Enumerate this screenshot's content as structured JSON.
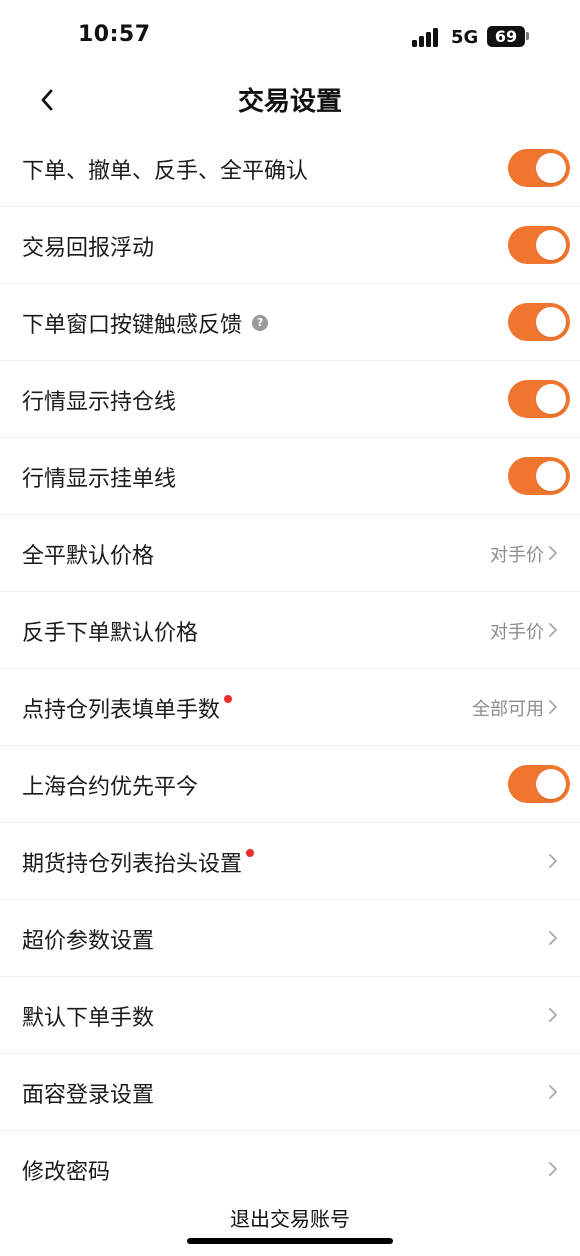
{
  "status_bar": {
    "time": "10:57",
    "network": "5G",
    "battery": "69"
  },
  "header": {
    "title": "交易设置"
  },
  "settings": [
    {
      "label": "下单、撤单、反手、全平确认",
      "type": "toggle",
      "enabled": true
    },
    {
      "label": "交易回报浮动",
      "type": "toggle",
      "enabled": true
    },
    {
      "label": "下单窗口按键触感反馈",
      "type": "toggle",
      "enabled": true,
      "has_help": true
    },
    {
      "label": "行情显示持仓线",
      "type": "toggle",
      "enabled": true
    },
    {
      "label": "行情显示挂单线",
      "type": "toggle",
      "enabled": true
    },
    {
      "label": "全平默认价格",
      "type": "value",
      "value": "对手价"
    },
    {
      "label": "反手下单默认价格",
      "type": "value",
      "value": "对手价"
    },
    {
      "label": "点持仓列表填单手数",
      "type": "value",
      "value": "全部可用",
      "badge": true
    },
    {
      "label": "上海合约优先平今",
      "type": "toggle",
      "enabled": true
    },
    {
      "label": "期货持仓列表抬头设置",
      "type": "link",
      "badge": true
    },
    {
      "label": "超价参数设置",
      "type": "link"
    },
    {
      "label": "默认下单手数",
      "type": "link"
    },
    {
      "label": "面容登录设置",
      "type": "link"
    },
    {
      "label": "修改密码",
      "type": "link"
    }
  ],
  "footer": {
    "logout_label": "退出交易账号"
  },
  "colors": {
    "accent": "#f0762f",
    "badge": "#ef2b2b"
  }
}
